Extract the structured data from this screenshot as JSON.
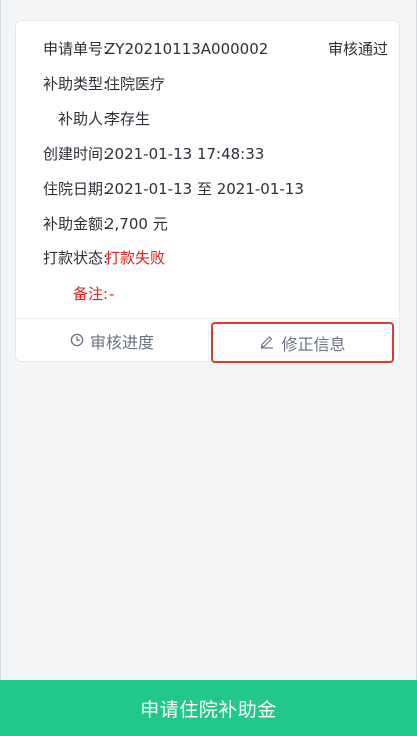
{
  "card": {
    "fields": {
      "application_no": {
        "label": "申请单号:",
        "value": "ZY20210113A000002"
      },
      "subsidy_type": {
        "label": "补助类型:",
        "value": "住院医疗"
      },
      "beneficiary": {
        "label": "补助人:",
        "value": "李存生"
      },
      "created_time": {
        "label": "创建时间:",
        "value": "2021-01-13 17:48:33"
      },
      "hospital_dates": {
        "label": "住院日期:",
        "value": "2021-01-13 至 2021-01-13"
      },
      "amount": {
        "label": "补助金额:",
        "value": "2,700 元"
      },
      "payment_status": {
        "label": "打款状态:",
        "value": "打款失败"
      },
      "remark": {
        "label": "备注:",
        "value": "-"
      }
    },
    "review_status": "审核通过",
    "actions": {
      "progress_label": "审核进度",
      "correct_label": "修正信息"
    }
  },
  "footer": {
    "apply_button_label": "申请住院补助金"
  },
  "colors": {
    "accent_green": "#22c78a",
    "error_red": "#e0201b",
    "highlight_border": "#e0392b"
  },
  "icons": {
    "progress": "clock-icon",
    "correct": "edit-pen-icon"
  }
}
